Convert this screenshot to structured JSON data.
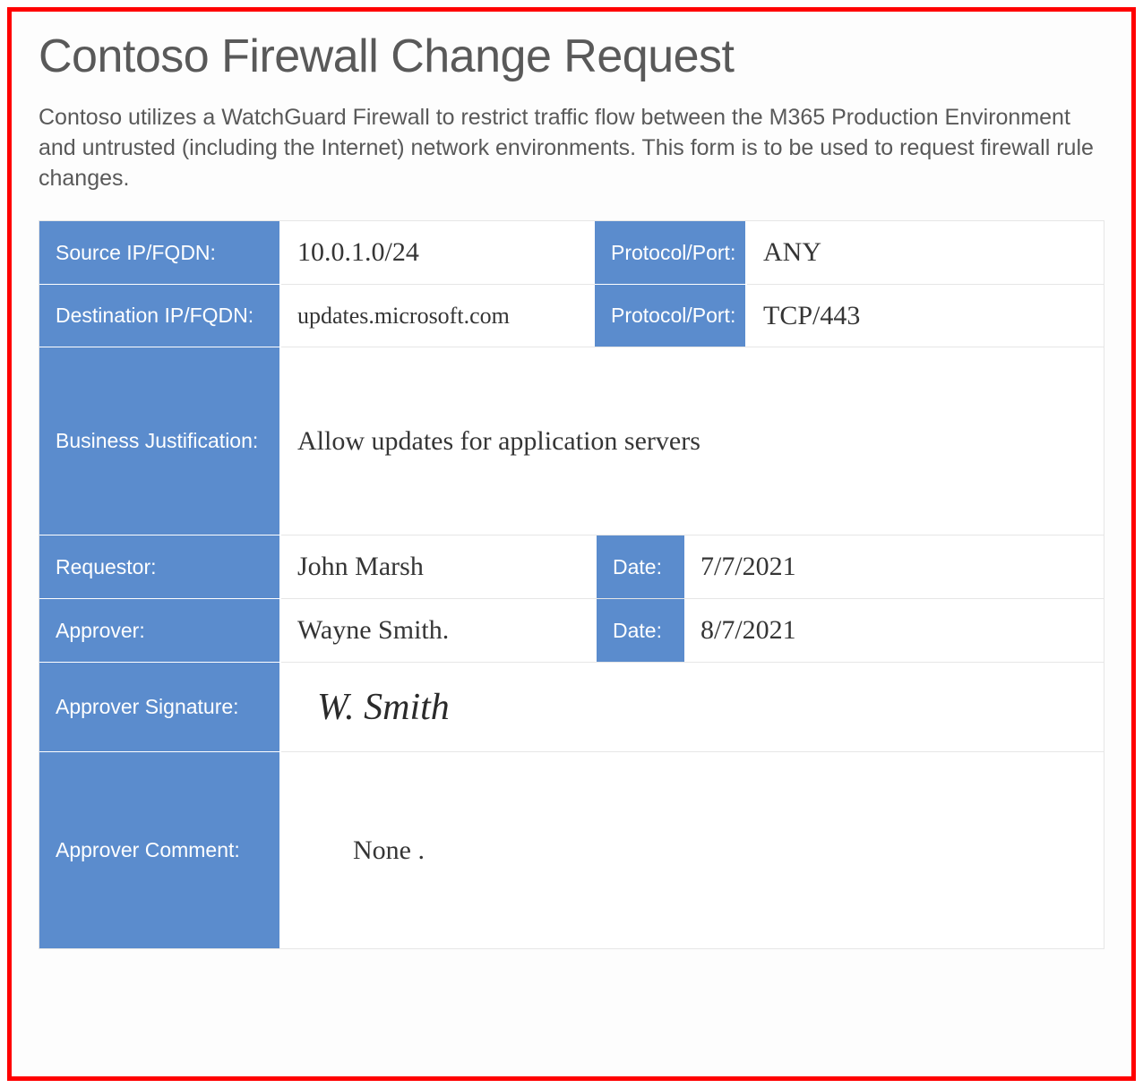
{
  "title": "Contoso Firewall Change Request",
  "intro": "Contoso utilizes a WatchGuard Firewall to restrict traffic flow between the M365 Production Environment and untrusted (including the Internet) network environments.  This form is to be used to request firewall rule changes.",
  "labels": {
    "source_ip": "Source IP/FQDN:",
    "dest_ip": "Destination IP/FQDN:",
    "protocol_port": "Protocol/Port:",
    "business_justification": "Business Justification:",
    "requestor": "Requestor:",
    "approver": "Approver:",
    "approver_signature": "Approver Signature:",
    "approver_comment": "Approver Comment:",
    "date": "Date:"
  },
  "values": {
    "source_ip": "10.0.1.0/24",
    "source_protocol": "ANY",
    "dest_ip": "updates.microsoft.com",
    "dest_protocol": "TCP/443",
    "business_justification": "Allow updates for application servers",
    "requestor": "John Marsh",
    "requestor_date": "7/7/2021",
    "approver": "Wayne Smith.",
    "approver_date": "8/7/2021",
    "approver_signature": "W. Smith",
    "approver_comment": "None ."
  }
}
